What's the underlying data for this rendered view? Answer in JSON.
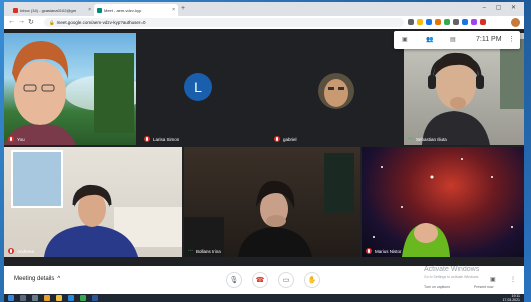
{
  "browser": {
    "tabs": [
      {
        "label": "Inbox (34) - gcasiana0102@gm",
        "favicon_color": "#d93025"
      },
      {
        "label": "Meet - aem-vdzv-kyp",
        "favicon_color": "#00897b"
      }
    ],
    "new_tab_label": "+",
    "url": "meet.google.com/aem-vdzv-kyp?authuser=0"
  },
  "meet": {
    "overlay": {
      "time": "7:11 PM"
    },
    "participants": [
      {
        "name": "You",
        "muted": true
      },
      {
        "name": "Larisa Simon",
        "initial": "L",
        "muted": true
      },
      {
        "name": "gabriel",
        "muted": true
      },
      {
        "name": "Sebastian Iliuta",
        "muted": false
      },
      {
        "name": "Andreea",
        "muted": true
      },
      {
        "name": "Bollans Irina",
        "muted": false
      },
      {
        "name": "Marius Nistor",
        "muted": true
      }
    ],
    "bottom": {
      "meeting_details": "Meeting details",
      "captions_label": "Turn on captions",
      "present_label": "Present now",
      "activate_title": "Activate Windows",
      "activate_sub": "Go to Settings to activate Windows."
    }
  },
  "taskbar": {
    "time": "19:11",
    "date": "17.03.2021"
  }
}
